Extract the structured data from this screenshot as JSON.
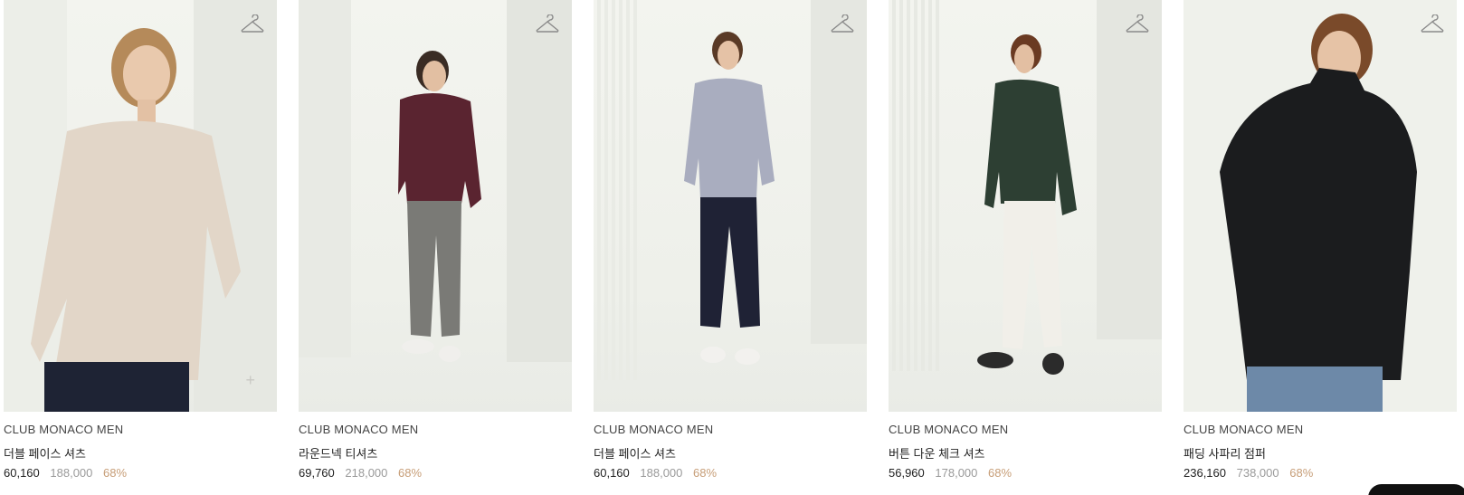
{
  "products": [
    {
      "brand": "CLUB MONACO MEN",
      "name": "더블 페이스 셔츠",
      "sale_price": "60,160",
      "original_price": "188,000",
      "discount": "68%",
      "top_color": "#e2d6c8",
      "bottom_color": "#23283a",
      "shoe_color": "#2a2a2a"
    },
    {
      "brand": "CLUB MONACO MEN",
      "name": "라운드넥 티셔츠",
      "sale_price": "69,760",
      "original_price": "218,000",
      "discount": "68%",
      "top_color": "#5a2430",
      "bottom_color": "#7a7a76",
      "shoe_color": "#f0efec"
    },
    {
      "brand": "CLUB MONACO MEN",
      "name": "더블 페이스 셔츠",
      "sale_price": "60,160",
      "original_price": "188,000",
      "discount": "68%",
      "top_color": "#a9adbf",
      "bottom_color": "#1f2235",
      "shoe_color": "#f2f1ee"
    },
    {
      "brand": "CLUB MONACO MEN",
      "name": "버튼 다운 체크 셔츠",
      "sale_price": "56,960",
      "original_price": "178,000",
      "discount": "68%",
      "top_color": "#2d3f33",
      "bottom_color": "#f1efe9",
      "shoe_color": "#2b2b2b"
    },
    {
      "brand": "CLUB MONACO MEN",
      "name": "패딩 사파리 점퍼",
      "sale_price": "236,160",
      "original_price": "738,000",
      "discount": "68%",
      "top_color": "#1b1c1e",
      "bottom_color": "#6d89a8",
      "shoe_color": "#2b2b2b"
    }
  ],
  "icons": {
    "wishlist": "hanger-icon",
    "add": "plus-icon"
  },
  "colors": {
    "discount": "#c79e78",
    "original_price": "#9a9a9a"
  }
}
